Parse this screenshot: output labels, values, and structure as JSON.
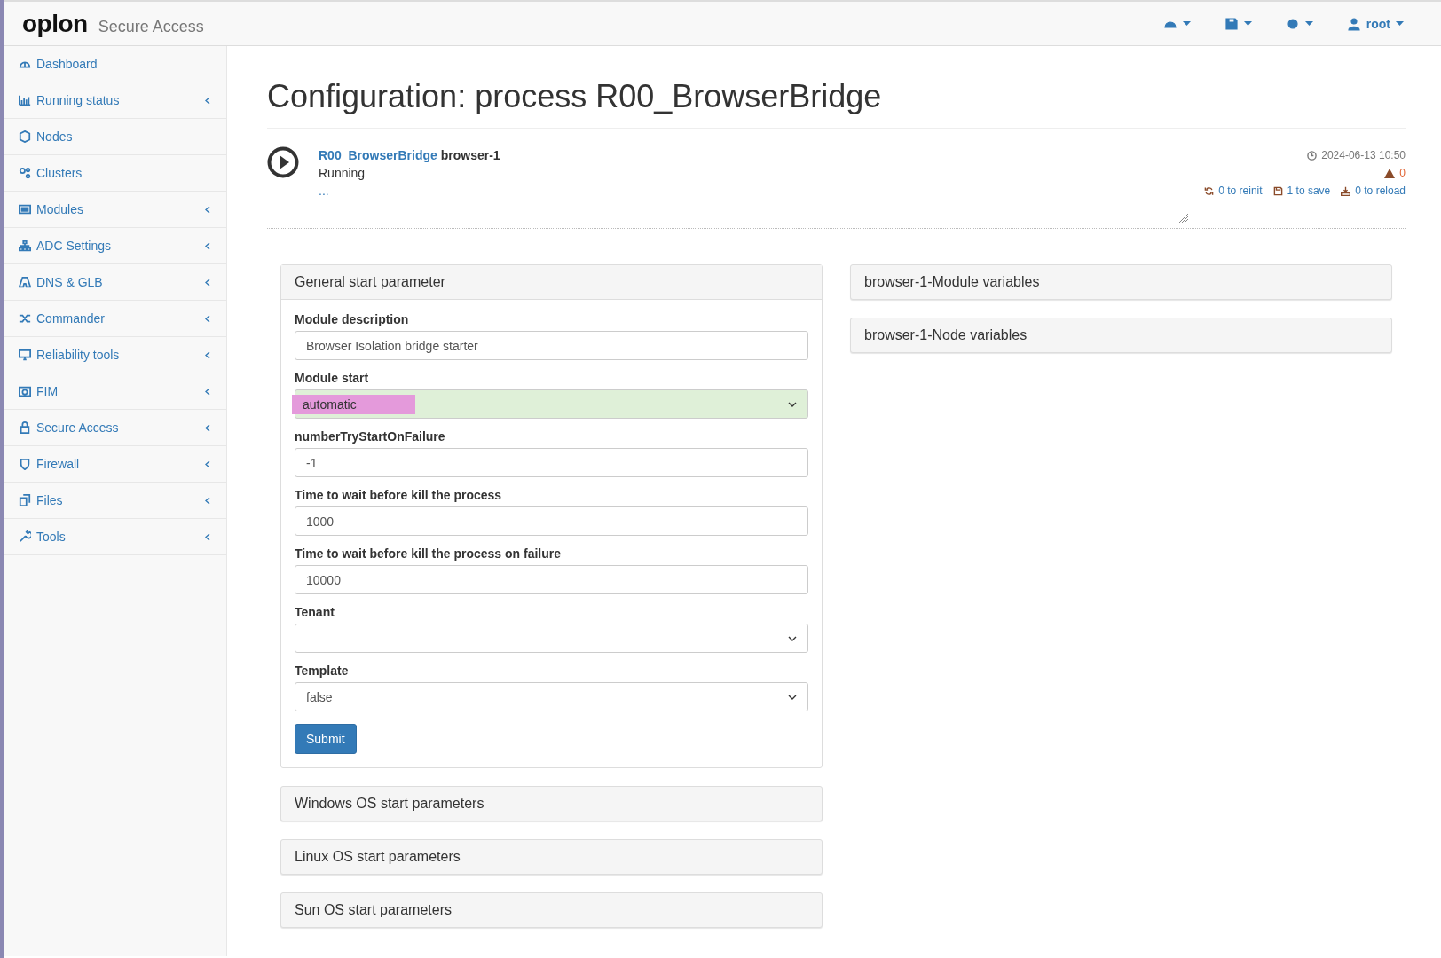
{
  "brand": {
    "logo": "oplon",
    "product": "Secure Access"
  },
  "topbar": {
    "menus": [
      {
        "kind": "dashboard"
      },
      {
        "kind": "save"
      },
      {
        "kind": "settings"
      },
      {
        "kind": "user",
        "label": "root"
      }
    ]
  },
  "sidebar": {
    "items": [
      {
        "label": "Dashboard",
        "expandable": false
      },
      {
        "label": "Running status",
        "expandable": true
      },
      {
        "label": "Nodes",
        "expandable": false
      },
      {
        "label": "Clusters",
        "expandable": false
      },
      {
        "label": "Modules",
        "expandable": true
      },
      {
        "label": "ADC Settings",
        "expandable": true
      },
      {
        "label": "DNS & GLB",
        "expandable": true
      },
      {
        "label": "Commander",
        "expandable": true
      },
      {
        "label": "Reliability tools",
        "expandable": true
      },
      {
        "label": "FIM",
        "expandable": true
      },
      {
        "label": "Secure Access",
        "expandable": true
      },
      {
        "label": "Firewall",
        "expandable": true
      },
      {
        "label": "Files",
        "expandable": true
      },
      {
        "label": "Tools",
        "expandable": true
      }
    ]
  },
  "page": {
    "title": "Configuration: process R00_BrowserBridge"
  },
  "process": {
    "name": "R00_BrowserBridge",
    "instance": "browser-1",
    "status": "Running",
    "note": "...",
    "timestamp": "2024-06-13 10:50",
    "warnings": "0",
    "actions": [
      {
        "kind": "reinit",
        "label": "0 to reinit"
      },
      {
        "kind": "save",
        "label": "1 to save"
      },
      {
        "kind": "reload",
        "label": "0 to reload"
      }
    ]
  },
  "general_panel": {
    "title": "General start parameter",
    "fields": [
      {
        "label": "Module description",
        "kind": "text",
        "value": "Browser Isolation bridge starter",
        "modified": false,
        "highlighted": false
      },
      {
        "label": "Module start",
        "kind": "select",
        "value": "automatic",
        "modified": true,
        "highlighted": true
      },
      {
        "label": "numberTryStartOnFailure",
        "kind": "text",
        "value": "-1",
        "modified": false,
        "highlighted": false
      },
      {
        "label": "Time to wait before kill the process",
        "kind": "text",
        "value": "1000",
        "modified": false,
        "highlighted": false
      },
      {
        "label": "Time to wait before kill the process on failure",
        "kind": "text",
        "value": "10000",
        "modified": false,
        "highlighted": false
      },
      {
        "label": "Tenant",
        "kind": "select",
        "modified": false,
        "highlighted": false
      },
      {
        "label": "Template",
        "kind": "select",
        "value": "false",
        "modified": false,
        "highlighted": false
      }
    ],
    "submit": "Submit"
  },
  "left_panels": [
    "Windows OS start parameters",
    "Linux OS start parameters",
    "Sun OS start parameters"
  ],
  "right_panels": [
    "browser-1-Module variables",
    "browser-1-Node variables"
  ]
}
